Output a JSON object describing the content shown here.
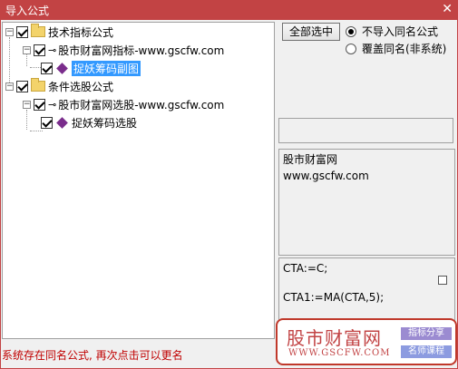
{
  "window": {
    "title": "导入公式",
    "close_glyph": "✕"
  },
  "tree": {
    "nodes": [
      {
        "label": "技术指标公式"
      },
      {
        "label": "股市财富网指标-www.gscfw.com"
      },
      {
        "label": "捉妖筹码副图"
      },
      {
        "label": "条件选股公式"
      },
      {
        "label": "股市财富网选股-www.gscfw.com"
      },
      {
        "label": "捉妖筹码选股"
      }
    ]
  },
  "options": {
    "select_all_label": "全部选中",
    "radio_skip_label": "不导入同名公式",
    "radio_overwrite_label": "覆盖同名(非系统)"
  },
  "description": {
    "line1": "股市财富网",
    "line2": "www.gscfw.com"
  },
  "code": {
    "line1": "CTA:=C;",
    "line2": "CTA1:=MA(CTA,5);"
  },
  "status": {
    "message": "系统存在同名公式, 再次点击可以更名"
  },
  "watermark": {
    "brand": "股市财富网",
    "url": "WWW.GSCFW.COM",
    "tag1": "指标分享",
    "tag2": "名师课程"
  },
  "colors": {
    "titlebar": "#c24344",
    "selection": "#3399ff",
    "status_text": "#c00000"
  }
}
